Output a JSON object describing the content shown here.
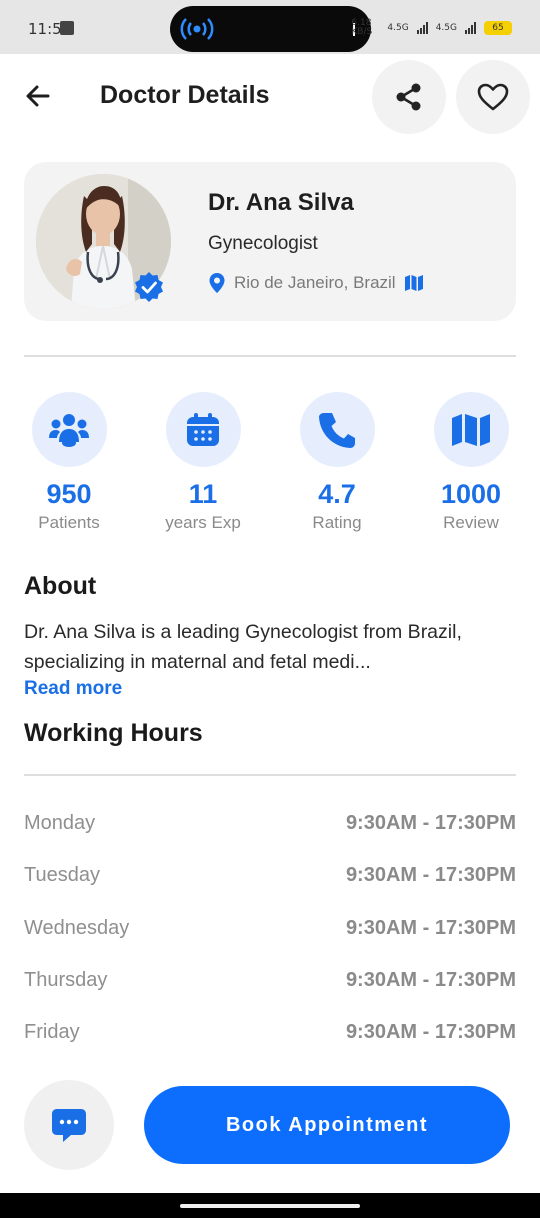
{
  "status_bar": {
    "time": "11:56",
    "net_speed": "6.18 KB/S",
    "signal_1": "4.5G",
    "signal_2": "4.5G",
    "battery": "65"
  },
  "header": {
    "title": "Doctor Details"
  },
  "doctor": {
    "name": "Dr. Ana Silva",
    "specialty": "Gynecologist",
    "location": "Rio de Janeiro, Brazil"
  },
  "stats": [
    {
      "value": "950",
      "label": "Patients",
      "icon": "people-icon"
    },
    {
      "value": "11",
      "label": "years Exp",
      "icon": "calendar-icon"
    },
    {
      "value": "4.7",
      "label": "Rating",
      "icon": "phone-icon"
    },
    {
      "value": "1000",
      "label": "Review",
      "icon": "map-icon"
    }
  ],
  "about": {
    "title": "About",
    "text": "Dr. Ana Silva is a leading Gynecologist from Brazil, specializing in maternal and fetal medi...",
    "read_more": "Read more"
  },
  "working_hours": {
    "title": "Working Hours",
    "rows": [
      {
        "day": "Monday",
        "time": "9:30AM - 17:30PM"
      },
      {
        "day": "Tuesday",
        "time": "9:30AM - 17:30PM"
      },
      {
        "day": "Wednesday",
        "time": "9:30AM - 17:30PM"
      },
      {
        "day": "Thursday",
        "time": "9:30AM - 17:30PM"
      },
      {
        "day": "Friday",
        "time": "9:30AM - 17:30PM"
      }
    ]
  },
  "actions": {
    "book_label": "Book Appointment"
  },
  "colors": {
    "accent": "#0d6efd",
    "accent_text": "#1a6fe6",
    "icon_bg": "#e6eefe"
  }
}
